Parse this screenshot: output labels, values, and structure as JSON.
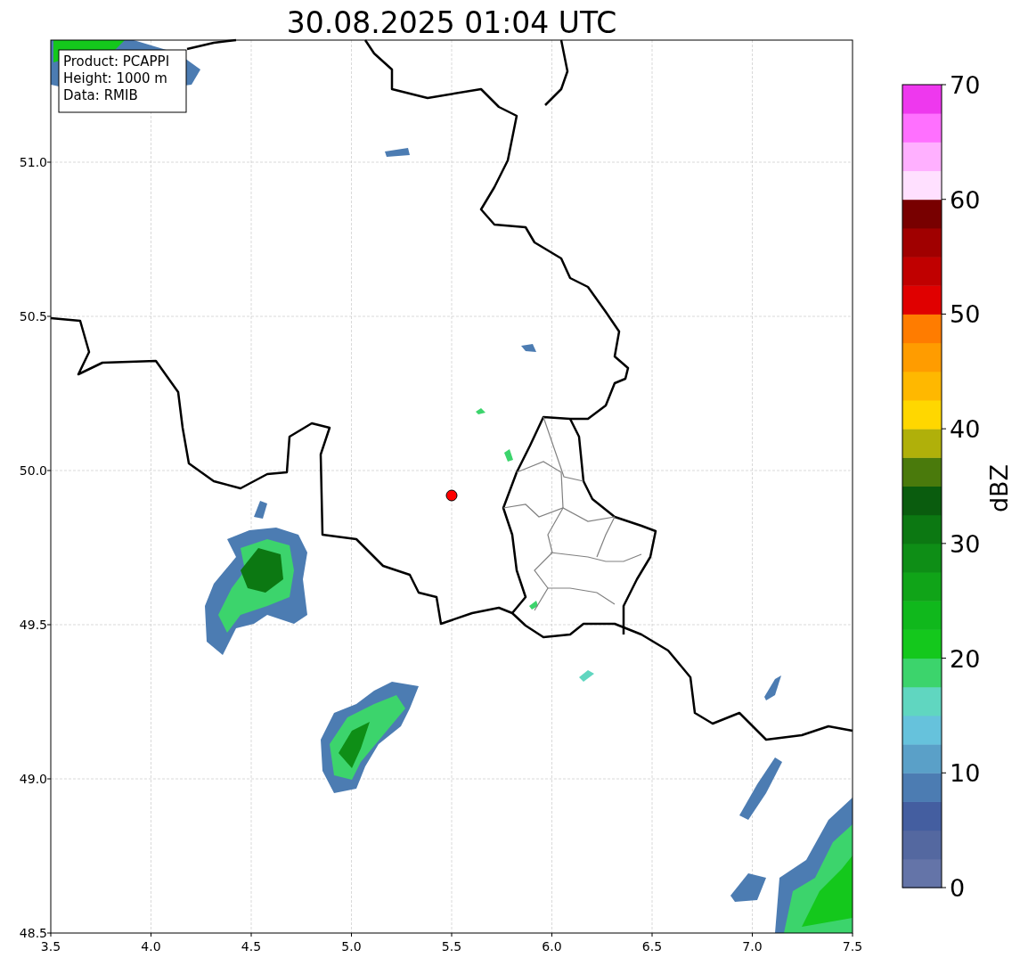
{
  "title": "30.08.2025 01:04 UTC",
  "info_box": [
    "Product: PCAPPI",
    "Height: 1000 m",
    "Data: RMIB"
  ],
  "x_ticks": [
    "3.5",
    "4.0",
    "4.5",
    "5.0",
    "5.5",
    "6.0",
    "6.5",
    "7.0",
    "7.5"
  ],
  "y_ticks": [
    "51.0",
    "50.5",
    "50.0",
    "49.5",
    "49.0",
    "48.5"
  ],
  "colorbar": {
    "label": "dBZ",
    "ticks": [
      "70",
      "60",
      "50",
      "40",
      "30",
      "20",
      "10",
      "0"
    ],
    "bands": [
      {
        "color": "#6474a8"
      },
      {
        "color": "#5468a0"
      },
      {
        "color": "#445ea0"
      },
      {
        "color": "#4c7cb2"
      },
      {
        "color": "#5aa0c8"
      },
      {
        "color": "#66c2dc"
      },
      {
        "color": "#60d6c0"
      },
      {
        "color": "#3cd46c"
      },
      {
        "color": "#14c81c"
      },
      {
        "color": "#10b81c"
      },
      {
        "color": "#10a418"
      },
      {
        "color": "#0e8e16"
      },
      {
        "color": "#0c7812"
      },
      {
        "color": "#0a5c0e"
      },
      {
        "color": "#4a7a0c"
      },
      {
        "color": "#b0b00a"
      },
      {
        "color": "#ffd700"
      },
      {
        "color": "#ffb800"
      },
      {
        "color": "#ff9c00"
      },
      {
        "color": "#ff7c00"
      },
      {
        "color": "#e00000"
      },
      {
        "color": "#c00000"
      },
      {
        "color": "#a00000"
      },
      {
        "color": "#780000"
      },
      {
        "color": "#ffe0ff"
      },
      {
        "color": "#ffb0ff"
      },
      {
        "color": "#ff70ff"
      },
      {
        "color": "#ee38ee"
      }
    ]
  }
}
